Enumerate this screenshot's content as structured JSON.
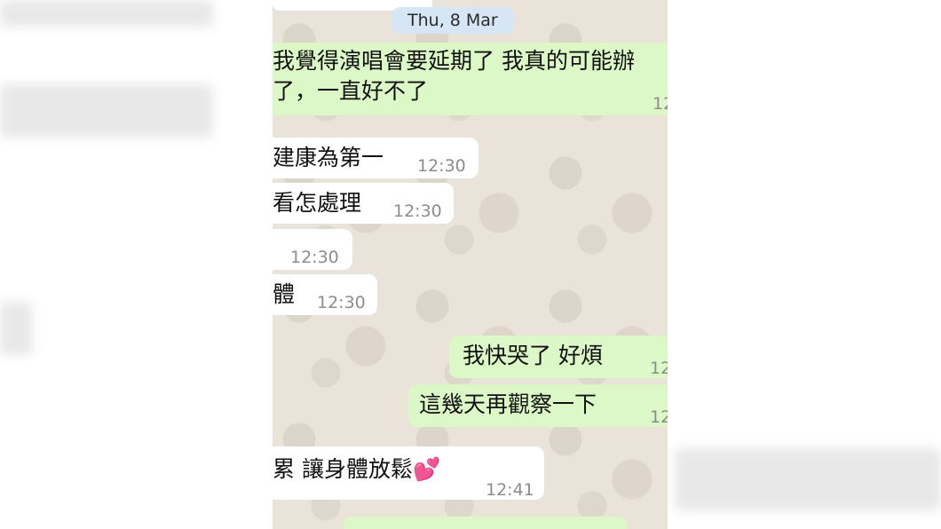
{
  "date_separator": "Thu, 8 Mar",
  "messages": [
    {
      "side": "out",
      "text_line1": "我覺得演唱會要延期了 我真的可能辦",
      "text_line2": "了，一直好不了",
      "time": "12"
    },
    {
      "side": "in",
      "text": "建康為第一",
      "time": "12:30"
    },
    {
      "side": "in",
      "text": "看怎處理",
      "time": "12:30"
    },
    {
      "side": "in",
      "text": "",
      "time": "12:30"
    },
    {
      "side": "in",
      "text": "體",
      "time": "12:30"
    },
    {
      "side": "out",
      "text": "我快哭了 好煩",
      "time": "12"
    },
    {
      "side": "out",
      "text": "這幾天再觀察一下",
      "time": "12"
    },
    {
      "side": "in",
      "text": "累 讓身體放鬆💕",
      "time": "12:41"
    }
  ]
}
